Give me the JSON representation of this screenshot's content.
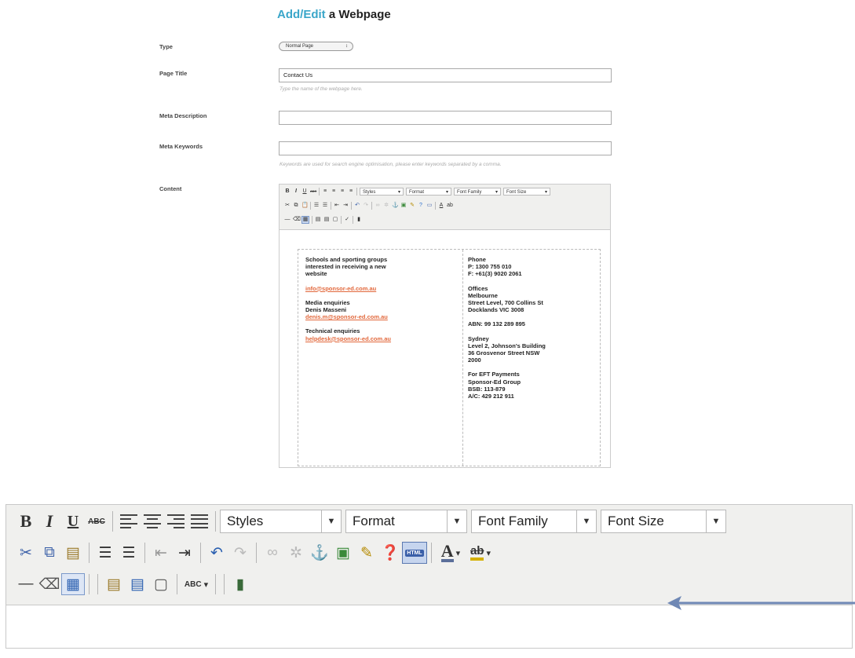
{
  "header": {
    "title_accent": "Add/Edit",
    "title_rest": " a Webpage"
  },
  "form": {
    "type_label": "Type",
    "type_value": "Normal Page",
    "page_title_label": "Page Title",
    "page_title_value": "Contact Us",
    "page_title_hint": "Type the name of the webpage here.",
    "meta_description_label": "Meta Description",
    "meta_description_value": "",
    "meta_keywords_label": "Meta Keywords",
    "meta_keywords_value": "",
    "meta_keywords_hint": "Keywords are used for search engine optimisation, please enter keywords separated by a comma.",
    "content_label": "Content"
  },
  "toolbar": {
    "styles": "Styles",
    "format": "Format",
    "font_family": "Font Family",
    "font_size": "Font Size",
    "bold": "B",
    "italic": "I",
    "underline": "U",
    "strike": "ABC",
    "html": "HTML",
    "spell": "ABC"
  },
  "content": {
    "left": {
      "intro_1": "Schools and sporting groups",
      "intro_2": "interested in receiving a new",
      "intro_3": "website",
      "info_email": "info@sponsor-ed.com.au",
      "media_heading": "Media enquiries",
      "media_name": "Denis Masseni",
      "media_email": "denis.m@sponsor-ed.com.au",
      "tech_heading": "Technical enquiries",
      "tech_email": "helpdesk@sponsor-ed.com.au"
    },
    "right": {
      "phone_heading": "Phone",
      "phone_p": "P: 1300 755 010",
      "phone_f": "F: +61(3) 9020 2061",
      "offices_heading": "Offices",
      "melbourne": "Melbourne",
      "melb_street": "Street Level, 700 Collins St",
      "melb_suburb": "Docklands VIC 3008",
      "abn": "ABN: 99 132 289 895",
      "sydney": "Sydney",
      "syd_1": "Level 2, Johnson's Building",
      "syd_2": "36 Grosvenor Street NSW",
      "syd_3": "2000",
      "eft_heading": "For EFT Payments",
      "eft_group": "Sponsor-Ed Group",
      "bsb": "BSB: 113-879",
      "ac": "A/C: 429 212 911"
    }
  },
  "colors": {
    "accent": "#3aa6c9",
    "link": "#e2683c",
    "arrow": "#6f88b5",
    "toolbar_bg": "#f0f0ee"
  }
}
